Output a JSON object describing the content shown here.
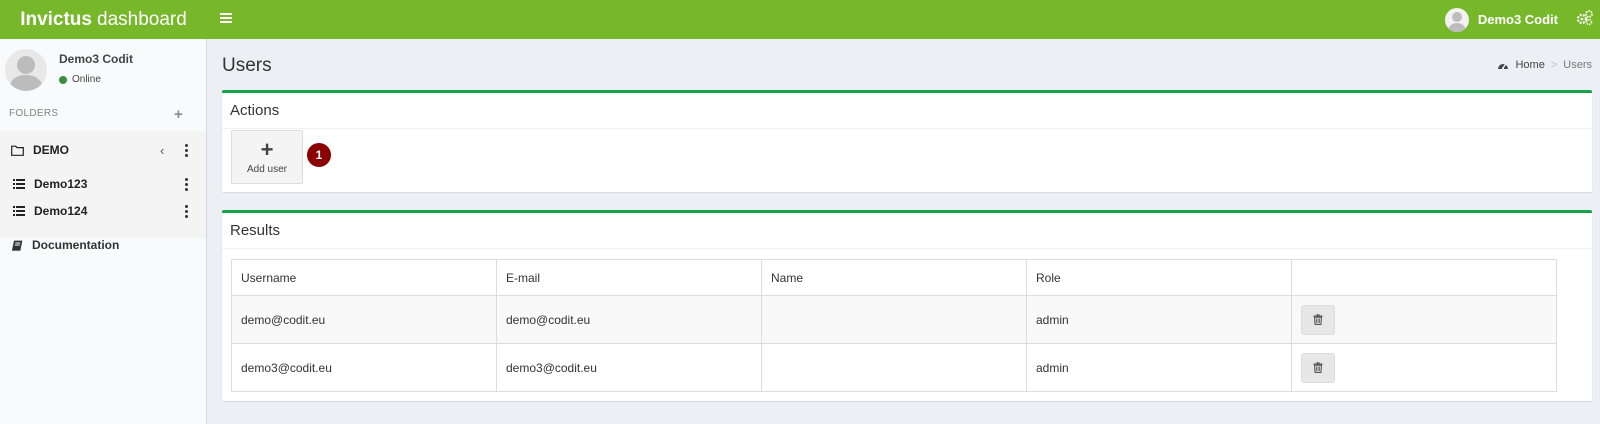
{
  "header": {
    "brand_bold": "Invictus",
    "brand_rest": "dashboard",
    "user_name": "Demo3 Codit",
    "accent_color": "#76b82a"
  },
  "sidebar": {
    "user_name": "Demo3 Codit",
    "status": "Online",
    "folders_header": "FOLDERS",
    "folders_add": "+",
    "tree": {
      "folder": "DEMO",
      "items": [
        {
          "label": "Demo123"
        },
        {
          "label": "Demo124"
        }
      ]
    },
    "documentation": "Documentation"
  },
  "page": {
    "title": "Users",
    "breadcrumb": {
      "home": "Home",
      "current": "Users"
    }
  },
  "actions": {
    "title": "Actions",
    "add_user_label": "Add user",
    "add_user_symbol": "+",
    "badge": "1"
  },
  "results": {
    "title": "Results",
    "columns": [
      "Username",
      "E-mail",
      "Name",
      "Role",
      ""
    ],
    "rows": [
      {
        "username": "demo@codit.eu",
        "email": "demo@codit.eu",
        "name": "",
        "role": "admin"
      },
      {
        "username": "demo3@codit.eu",
        "email": "demo3@codit.eu",
        "name": "",
        "role": "admin"
      }
    ]
  }
}
